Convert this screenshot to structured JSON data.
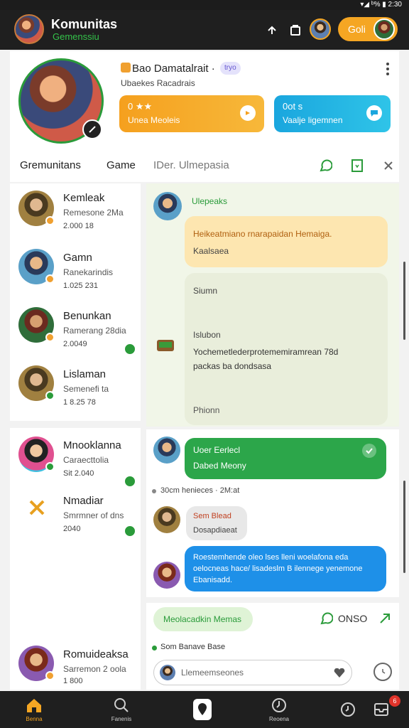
{
  "status": {
    "text": "▾◢ ᵇ% ▮ 2:30"
  },
  "header": {
    "title": "Komunitas",
    "subtitle": "Gemenssiu",
    "gold_label": "Goli",
    "colors": {
      "bar": "#1f1f1f",
      "accent": "#2a9b3a",
      "gold": "#f5a623"
    }
  },
  "profile": {
    "name": "Bao Damatalrait ·",
    "tag": "tryo",
    "sub": "Ubaekes Racadrais",
    "card1_title": "0 ★★",
    "card1_sub": "Unea Meoleis",
    "card2_title": "0ot s",
    "card2_sub": "Vaalje ligemnen"
  },
  "tabs": [
    "Gremunitans",
    "Game",
    "IDer. Ulmepasia"
  ],
  "list": [
    {
      "name": "Kemleak",
      "sub": "Remesone 2Ma",
      "meta": "2.000 18"
    },
    {
      "name": "Gamn",
      "sub": "Ranekarindis",
      "meta": "1.025 231"
    },
    {
      "name": "Benunkan",
      "sub": "Ramerang 28dia",
      "meta": "2.0049"
    },
    {
      "name": "Lislaman",
      "sub": "Semenefi ta",
      "meta": "1 8.25 78"
    }
  ],
  "list2": [
    {
      "name": "Mnooklanna",
      "sub": "Caraecttolia",
      "meta": "Sit 2.040"
    },
    {
      "name": "Nmadiar",
      "sub": "Smrmner of dns",
      "meta": "2040"
    }
  ],
  "list3": {
    "name": "Romuideaksa",
    "sub": "Sarremon 2 oola",
    "meta": "1 800"
  },
  "chat": {
    "sender": "Ulepeaks",
    "bubble1_line1": "Heikeatmiano rnarapaidan Hemaiga.",
    "bubble1_line2": "Kaalsaea",
    "msg1": "Siumn",
    "msg2": "Islubon",
    "msg3_line1": "Yochemetlederprotememiramrean 78d",
    "msg3_line2": "packas ba dondsasa",
    "msg4": "Phionn"
  },
  "chat2": {
    "green_title": "Uoer Eerlecl",
    "green_sub": "Dabed Meony",
    "note": "30cm henieces · 2M:at",
    "grey_title": "Sem Blead",
    "grey_sub": "Dosapdiaeat",
    "blue_line1": "Roestemhende oleo lses lleni woelafona eda",
    "blue_line2": "oelocneas hace/ lisadeslm B ilennege yenemone",
    "blue_line3": "Ebanisadd."
  },
  "compose": {
    "chip": "Meolacadkin Memas",
    "count": "ONSO",
    "status": "Som Banave Base",
    "placeholder": "Llemeemseones"
  },
  "nav": [
    "Benna",
    "Fanenis",
    "",
    "Reoena",
    "",
    ""
  ],
  "nav_badge": "6"
}
